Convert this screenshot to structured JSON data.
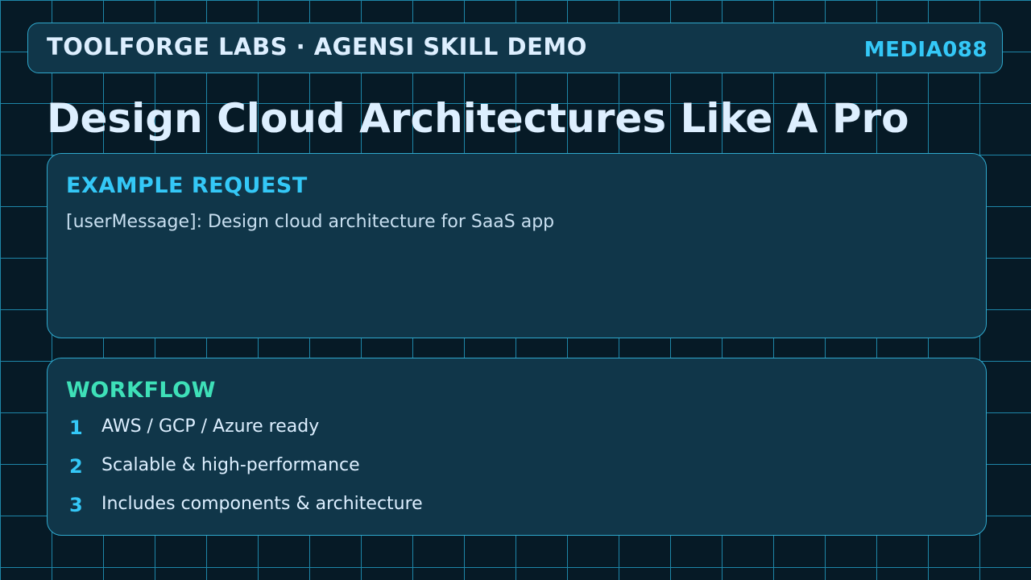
{
  "header": {
    "brand": "TOOLFORGE LABS · AGENSI SKILL DEMO",
    "code": "MEDIA088"
  },
  "title": "Design Cloud Architectures Like A Pro",
  "example_request": {
    "heading": "EXAMPLE REQUEST",
    "text": "[userMessage]: Design cloud architecture for SaaS app"
  },
  "workflow": {
    "heading": "WORKFLOW",
    "steps": [
      {
        "number": "1",
        "text": "AWS / GCP / Azure ready"
      },
      {
        "number": "2",
        "text": "Scalable & high-performance"
      },
      {
        "number": "3",
        "text": "Includes components & architecture"
      }
    ]
  },
  "colors": {
    "background": "#061a26",
    "grid_line": "#1e86a8",
    "panel": "#103649",
    "panel_border": "#2fa8cc",
    "accent_cyan": "#34c8f7",
    "accent_green": "#3ee0b8",
    "text_light": "#ddefff"
  }
}
